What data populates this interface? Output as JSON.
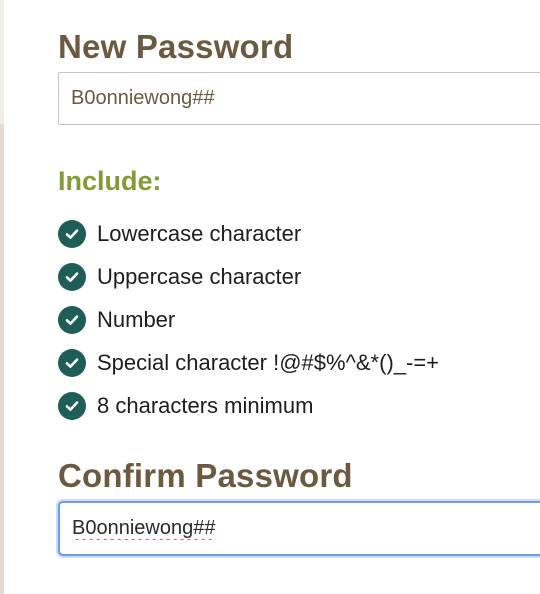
{
  "new_password": {
    "label": "New Password",
    "value": "B0onniewong##"
  },
  "requirements": {
    "heading": "Include:",
    "items": [
      {
        "label": "Lowercase character",
        "met": true,
        "icon": "check-circle-icon"
      },
      {
        "label": "Uppercase character",
        "met": true,
        "icon": "check-circle-icon"
      },
      {
        "label": "Number",
        "met": true,
        "icon": "check-circle-icon"
      },
      {
        "label": "Special character !@#$%^&*()_-=+",
        "met": true,
        "icon": "check-circle-icon"
      },
      {
        "label": "8 characters minimum",
        "met": true,
        "icon": "check-circle-icon"
      }
    ]
  },
  "confirm_password": {
    "label": "Confirm Password",
    "value": "B0onniewong##"
  },
  "colors": {
    "label": "#6b5a3f",
    "include_heading": "#7f9d34",
    "check_fill": "#1f5e58",
    "focus_border": "#6d9ce6"
  }
}
